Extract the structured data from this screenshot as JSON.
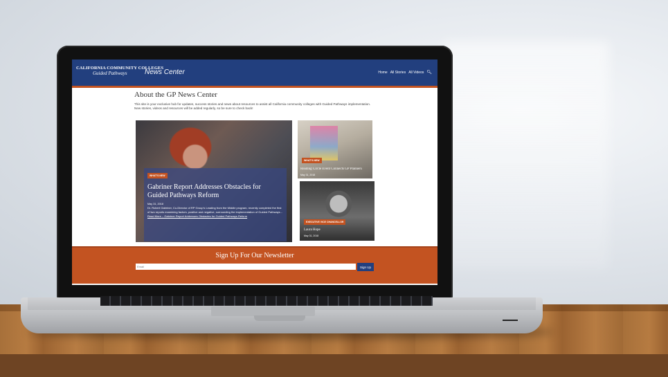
{
  "site": {
    "logo_top": "CALIFORNIA COMMUNITY COLLEGES",
    "logo_bottom": "Guided Pathways",
    "section_title": "News Center",
    "nav": [
      "Home",
      "All Stories",
      "All Videos"
    ],
    "search_icon": "search-icon"
  },
  "about": {
    "title": "About the GP News Center",
    "text": "This site is your exclusive hub for updates, success stories and news about resources to assist all California community colleges with Guided Pathways implementation. New stories, videos and resources will be added regularly, so be sure to check back!"
  },
  "feature": {
    "badge": "WHAT'S NEW",
    "title": "Gabriner Report Addresses Obstacles for Guided Pathways Reform",
    "date": "May 31, 2018",
    "excerpt": "Dr. Robert Gabriner, Co-Director of RP Group's Leading from the Middle program, recently completed the first of two reports examining factors, positive and negative, surrounding the implementation of Guided Pathways...",
    "read_more": "Read More – Gabriner Report Addresses Obstacles for Guided Pathways Reform"
  },
  "side_stories": [
    {
      "badge": "WHAT'S NEW",
      "title": "Reading Circle Event Connects GP Planners",
      "date": "May 31, 2018"
    },
    {
      "badge": "EXECUTIVE VICE CHANCELLOR",
      "title": "Laura Hope",
      "date": "May 31, 2018"
    }
  ],
  "newsletter": {
    "title": "Sign Up For Our Newsletter",
    "placeholder": "Email",
    "button": "Sign Up"
  },
  "colors": {
    "brand_blue": "#223f7e",
    "accent_orange": "#c35321"
  }
}
